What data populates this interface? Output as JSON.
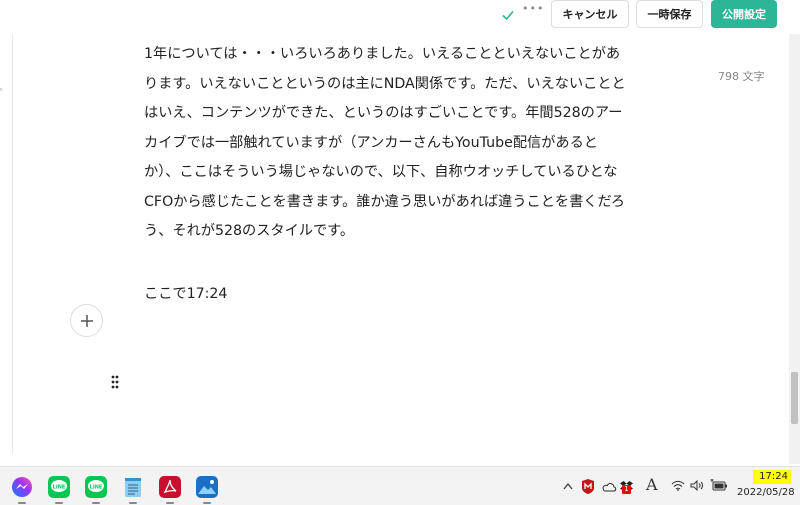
{
  "toolbar": {
    "cancel_label": "キャンセル",
    "draft_label": "一時保存",
    "publish_label": "公開設定",
    "more_label": "•••"
  },
  "editor": {
    "char_count": "798 文字",
    "paragraph_lines": [
      "1年については・・・いろいろありました。いえることといえないことがあ",
      "ります。いえないことというのは主にNDA関係です。ただ、いえないことと",
      "はいえ、コンテンツができた、というのはすごいことです。年間528のアー",
      "カイブでは一部触れていますが（アンカーさんもYouTube配信があると",
      "か）、ここはそういう場じゃないので、以下、自称ウオッチしているひとな",
      "CFOから感じたことを書きます。誰か違う思いがあれば違うことを書くだろ",
      "う、それが528のスタイルです。"
    ],
    "time_line": "ここで17:24",
    "side_mark": "ᵋ"
  },
  "taskbar": {
    "apps": [
      "messenger-icon",
      "line-icon",
      "line-icon",
      "notepad-icon",
      "acrobat-icon",
      "photos-icon"
    ],
    "ime_label": "A",
    "notif_badge": "1",
    "clock_time": "17:24",
    "clock_date": "2022/05/28"
  },
  "colors": {
    "accent": "#2cb696",
    "highlight": "#ffff00"
  }
}
